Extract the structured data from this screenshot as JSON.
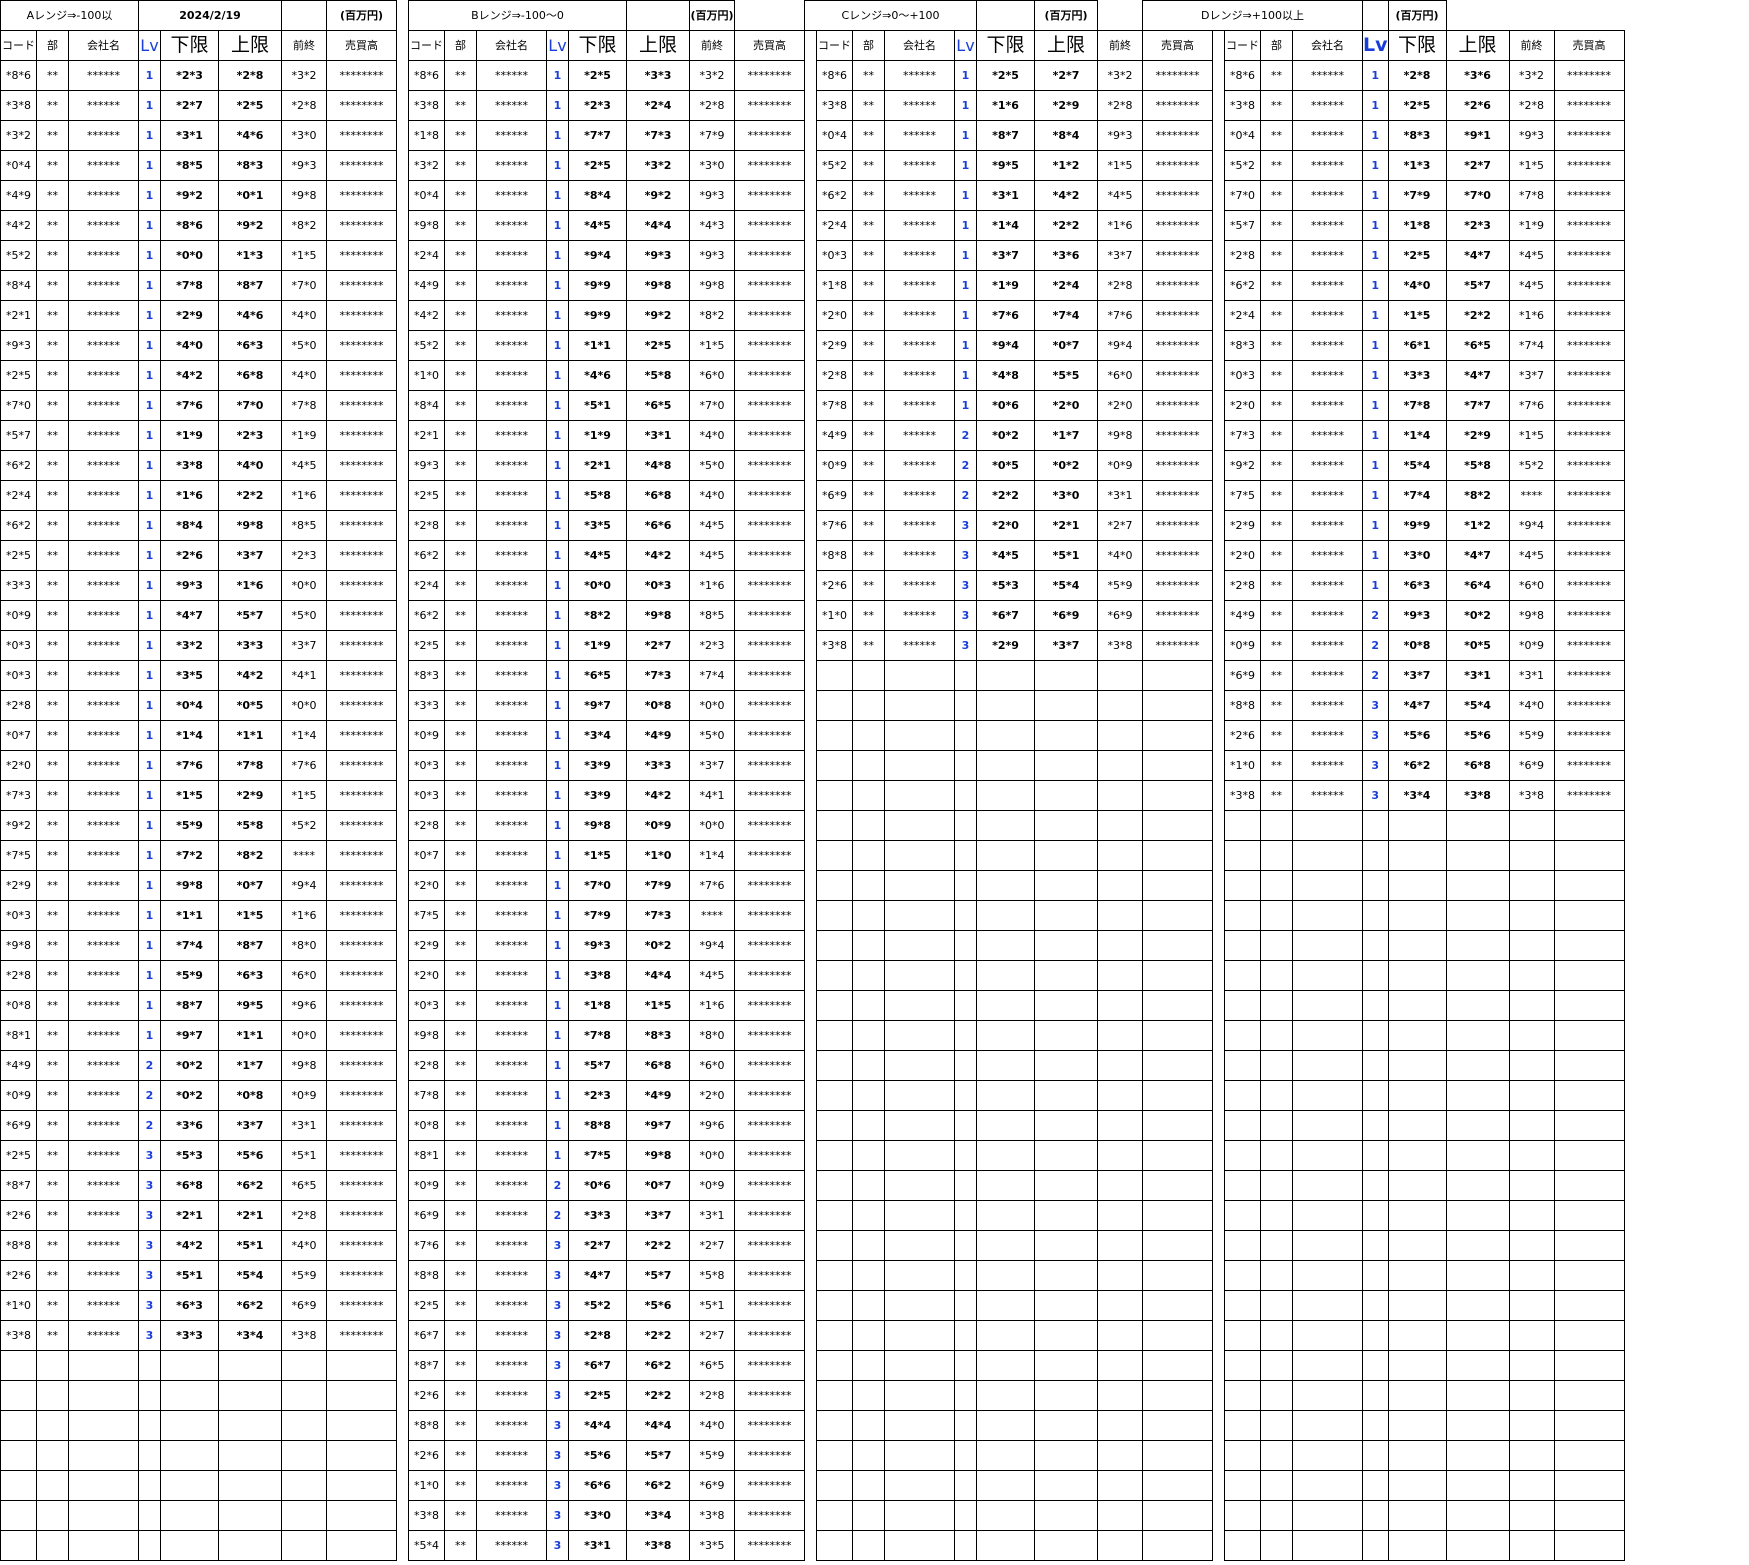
{
  "header": {
    "date": "2024/2/19",
    "unit_label": "(百万円)",
    "sections": [
      {
        "key": "A",
        "title": "Aレンジ⇒-100以"
      },
      {
        "key": "B",
        "title": "Bレンジ⇒-100〜0"
      },
      {
        "key": "C",
        "title": "Cレンジ⇒0〜+100"
      },
      {
        "key": "D",
        "title": "Dレンジ⇒+100以上"
      }
    ],
    "columns": [
      "コード",
      "部",
      "会社名",
      "Lv",
      "下限",
      "上限",
      "前終",
      "売買高"
    ]
  },
  "colors": {
    "lv": "#1a3fd9",
    "grid": "#000000"
  },
  "masks": {
    "bu": "**",
    "name": "******",
    "sales": "********"
  },
  "sections": {
    "A": [
      [
        "*8*6",
        "1",
        "*2*3",
        "*2*8",
        "*3*2"
      ],
      [
        "*3*8",
        "1",
        "*2*7",
        "*2*5",
        "*2*8"
      ],
      [
        "*3*2",
        "1",
        "*3*1",
        "*4*6",
        "*3*0"
      ],
      [
        "*0*4",
        "1",
        "*8*5",
        "*8*3",
        "*9*3"
      ],
      [
        "*4*9",
        "1",
        "*9*2",
        "*0*1",
        "*9*8"
      ],
      [
        "*4*2",
        "1",
        "*8*6",
        "*9*2",
        "*8*2"
      ],
      [
        "*5*2",
        "1",
        "*0*0",
        "*1*3",
        "*1*5"
      ],
      [
        "*8*4",
        "1",
        "*7*8",
        "*8*7",
        "*7*0"
      ],
      [
        "*2*1",
        "1",
        "*2*9",
        "*4*6",
        "*4*0"
      ],
      [
        "*9*3",
        "1",
        "*4*0",
        "*6*3",
        "*5*0"
      ],
      [
        "*2*5",
        "1",
        "*4*2",
        "*6*8",
        "*4*0"
      ],
      [
        "*7*0",
        "1",
        "*7*6",
        "*7*0",
        "*7*8"
      ],
      [
        "*5*7",
        "1",
        "*1*9",
        "*2*3",
        "*1*9"
      ],
      [
        "*6*2",
        "1",
        "*3*8",
        "*4*0",
        "*4*5"
      ],
      [
        "*2*4",
        "1",
        "*1*6",
        "*2*2",
        "*1*6"
      ],
      [
        "*6*2",
        "1",
        "*8*4",
        "*9*8",
        "*8*5"
      ],
      [
        "*2*5",
        "1",
        "*2*6",
        "*3*7",
        "*2*3"
      ],
      [
        "*3*3",
        "1",
        "*9*3",
        "*1*6",
        "*0*0"
      ],
      [
        "*0*9",
        "1",
        "*4*7",
        "*5*7",
        "*5*0"
      ],
      [
        "*0*3",
        "1",
        "*3*2",
        "*3*3",
        "*3*7"
      ],
      [
        "*0*3",
        "1",
        "*3*5",
        "*4*2",
        "*4*1"
      ],
      [
        "*2*8",
        "1",
        "*0*4",
        "*0*5",
        "*0*0"
      ],
      [
        "*0*7",
        "1",
        "*1*4",
        "*1*1",
        "*1*4"
      ],
      [
        "*2*0",
        "1",
        "*7*6",
        "*7*8",
        "*7*6"
      ],
      [
        "*7*3",
        "1",
        "*1*5",
        "*2*9",
        "*1*5"
      ],
      [
        "*9*2",
        "1",
        "*5*9",
        "*5*8",
        "*5*2"
      ],
      [
        "*7*5",
        "1",
        "*7*2",
        "*8*2",
        "****"
      ],
      [
        "*2*9",
        "1",
        "*9*8",
        "*0*7",
        "*9*4"
      ],
      [
        "*0*3",
        "1",
        "*1*1",
        "*1*5",
        "*1*6"
      ],
      [
        "*9*8",
        "1",
        "*7*4",
        "*8*7",
        "*8*0"
      ],
      [
        "*2*8",
        "1",
        "*5*9",
        "*6*3",
        "*6*0"
      ],
      [
        "*0*8",
        "1",
        "*8*7",
        "*9*5",
        "*9*6"
      ],
      [
        "*8*1",
        "1",
        "*9*7",
        "*1*1",
        "*0*0"
      ],
      [
        "*4*9",
        "2",
        "*0*2",
        "*1*7",
        "*9*8"
      ],
      [
        "*0*9",
        "2",
        "*0*2",
        "*0*8",
        "*0*9"
      ],
      [
        "*6*9",
        "2",
        "*3*6",
        "*3*7",
        "*3*1"
      ],
      [
        "*2*5",
        "3",
        "*5*3",
        "*5*6",
        "*5*1"
      ],
      [
        "*8*7",
        "3",
        "*6*8",
        "*6*2",
        "*6*5"
      ],
      [
        "*2*6",
        "3",
        "*2*1",
        "*2*1",
        "*2*8"
      ],
      [
        "*8*8",
        "3",
        "*4*2",
        "*5*1",
        "*4*0"
      ],
      [
        "*2*6",
        "3",
        "*5*1",
        "*5*4",
        "*5*9"
      ],
      [
        "*1*0",
        "3",
        "*6*3",
        "*6*2",
        "*6*9"
      ],
      [
        "*3*8",
        "3",
        "*3*3",
        "*3*4",
        "*3*8"
      ]
    ],
    "B": [
      [
        "*8*6",
        "1",
        "*2*5",
        "*3*3",
        "*3*2"
      ],
      [
        "*3*8",
        "1",
        "*2*3",
        "*2*4",
        "*2*8"
      ],
      [
        "*1*8",
        "1",
        "*7*7",
        "*7*3",
        "*7*9"
      ],
      [
        "*3*2",
        "1",
        "*2*5",
        "*3*2",
        "*3*0"
      ],
      [
        "*0*4",
        "1",
        "*8*4",
        "*9*2",
        "*9*3"
      ],
      [
        "*9*8",
        "1",
        "*4*5",
        "*4*4",
        "*4*3"
      ],
      [
        "*2*4",
        "1",
        "*9*4",
        "*9*3",
        "*9*3"
      ],
      [
        "*4*9",
        "1",
        "*9*9",
        "*9*8",
        "*9*8"
      ],
      [
        "*4*2",
        "1",
        "*9*9",
        "*9*2",
        "*8*2"
      ],
      [
        "*5*2",
        "1",
        "*1*1",
        "*2*5",
        "*1*5"
      ],
      [
        "*1*0",
        "1",
        "*4*6",
        "*5*8",
        "*6*0"
      ],
      [
        "*8*4",
        "1",
        "*5*1",
        "*6*5",
        "*7*0"
      ],
      [
        "*2*1",
        "1",
        "*1*9",
        "*3*1",
        "*4*0"
      ],
      [
        "*9*3",
        "1",
        "*2*1",
        "*4*8",
        "*5*0"
      ],
      [
        "*2*5",
        "1",
        "*5*8",
        "*6*8",
        "*4*0"
      ],
      [
        "*2*8",
        "1",
        "*3*5",
        "*6*6",
        "*4*5"
      ],
      [
        "*6*2",
        "1",
        "*4*5",
        "*4*2",
        "*4*5"
      ],
      [
        "*2*4",
        "1",
        "*0*0",
        "*0*3",
        "*1*6"
      ],
      [
        "*6*2",
        "1",
        "*8*2",
        "*9*8",
        "*8*5"
      ],
      [
        "*2*5",
        "1",
        "*1*9",
        "*2*7",
        "*2*3"
      ],
      [
        "*8*3",
        "1",
        "*6*5",
        "*7*3",
        "*7*4"
      ],
      [
        "*3*3",
        "1",
        "*9*7",
        "*0*8",
        "*0*0"
      ],
      [
        "*0*9",
        "1",
        "*3*4",
        "*4*9",
        "*5*0"
      ],
      [
        "*0*3",
        "1",
        "*3*9",
        "*3*3",
        "*3*7"
      ],
      [
        "*0*3",
        "1",
        "*3*9",
        "*4*2",
        "*4*1"
      ],
      [
        "*2*8",
        "1",
        "*9*8",
        "*0*9",
        "*0*0"
      ],
      [
        "*0*7",
        "1",
        "*1*5",
        "*1*0",
        "*1*4"
      ],
      [
        "*2*0",
        "1",
        "*7*0",
        "*7*9",
        "*7*6"
      ],
      [
        "*7*5",
        "1",
        "*7*9",
        "*7*3",
        "****"
      ],
      [
        "*2*9",
        "1",
        "*9*3",
        "*0*2",
        "*9*4"
      ],
      [
        "*2*0",
        "1",
        "*3*8",
        "*4*4",
        "*4*5"
      ],
      [
        "*0*3",
        "1",
        "*1*8",
        "*1*5",
        "*1*6"
      ],
      [
        "*9*8",
        "1",
        "*7*8",
        "*8*3",
        "*8*0"
      ],
      [
        "*2*8",
        "1",
        "*5*7",
        "*6*8",
        "*6*0"
      ],
      [
        "*7*8",
        "1",
        "*2*3",
        "*4*9",
        "*2*0"
      ],
      [
        "*0*8",
        "1",
        "*8*8",
        "*9*7",
        "*9*6"
      ],
      [
        "*8*1",
        "1",
        "*7*5",
        "*9*8",
        "*0*0"
      ],
      [
        "*0*9",
        "2",
        "*0*6",
        "*0*7",
        "*0*9"
      ],
      [
        "*6*9",
        "2",
        "*3*3",
        "*3*7",
        "*3*1"
      ],
      [
        "*7*6",
        "3",
        "*2*7",
        "*2*2",
        "*2*7"
      ],
      [
        "*8*8",
        "3",
        "*4*7",
        "*5*7",
        "*5*8"
      ],
      [
        "*2*5",
        "3",
        "*5*2",
        "*5*6",
        "*5*1"
      ],
      [
        "*6*7",
        "3",
        "*2*8",
        "*2*2",
        "*2*7"
      ],
      [
        "*8*7",
        "3",
        "*6*7",
        "*6*2",
        "*6*5"
      ],
      [
        "*2*6",
        "3",
        "*2*5",
        "*2*2",
        "*2*8"
      ],
      [
        "*8*8",
        "3",
        "*4*4",
        "*4*4",
        "*4*0"
      ],
      [
        "*2*6",
        "3",
        "*5*6",
        "*5*7",
        "*5*9"
      ],
      [
        "*1*0",
        "3",
        "*6*6",
        "*6*2",
        "*6*9"
      ],
      [
        "*3*8",
        "3",
        "*3*0",
        "*3*4",
        "*3*8"
      ],
      [
        "*5*4",
        "3",
        "*3*1",
        "*3*8",
        "*3*5"
      ]
    ],
    "C": [
      [
        "*8*6",
        "1",
        "*2*5",
        "*2*7",
        "*3*2"
      ],
      [
        "*3*8",
        "1",
        "*1*6",
        "*2*9",
        "*2*8"
      ],
      [
        "*0*4",
        "1",
        "*8*7",
        "*8*4",
        "*9*3"
      ],
      [
        "*5*2",
        "1",
        "*9*5",
        "*1*2",
        "*1*5"
      ],
      [
        "*6*2",
        "1",
        "*3*1",
        "*4*2",
        "*4*5"
      ],
      [
        "*2*4",
        "1",
        "*1*4",
        "*2*2",
        "*1*6"
      ],
      [
        "*0*3",
        "1",
        "*3*7",
        "*3*6",
        "*3*7"
      ],
      [
        "*1*8",
        "1",
        "*1*9",
        "*2*4",
        "*2*8"
      ],
      [
        "*2*0",
        "1",
        "*7*6",
        "*7*4",
        "*7*6"
      ],
      [
        "*2*9",
        "1",
        "*9*4",
        "*0*7",
        "*9*4"
      ],
      [
        "*2*8",
        "1",
        "*4*8",
        "*5*5",
        "*6*0"
      ],
      [
        "*7*8",
        "1",
        "*0*6",
        "*2*0",
        "*2*0"
      ],
      [
        "*4*9",
        "2",
        "*0*2",
        "*1*7",
        "*9*8"
      ],
      [
        "*0*9",
        "2",
        "*0*5",
        "*0*2",
        "*0*9"
      ],
      [
        "*6*9",
        "2",
        "*2*2",
        "*3*0",
        "*3*1"
      ],
      [
        "*7*6",
        "3",
        "*2*0",
        "*2*1",
        "*2*7"
      ],
      [
        "*8*8",
        "3",
        "*4*5",
        "*5*1",
        "*4*0"
      ],
      [
        "*2*6",
        "3",
        "*5*3",
        "*5*4",
        "*5*9"
      ],
      [
        "*1*0",
        "3",
        "*6*7",
        "*6*9",
        "*6*9"
      ],
      [
        "*3*8",
        "3",
        "*2*9",
        "*3*7",
        "*3*8"
      ]
    ],
    "D": [
      [
        "*8*6",
        "1",
        "*2*8",
        "*3*6",
        "*3*2"
      ],
      [
        "*3*8",
        "1",
        "*2*5",
        "*2*6",
        "*2*8"
      ],
      [
        "*0*4",
        "1",
        "*8*3",
        "*9*1",
        "*9*3"
      ],
      [
        "*5*2",
        "1",
        "*1*3",
        "*2*7",
        "*1*5"
      ],
      [
        "*7*0",
        "1",
        "*7*9",
        "*7*0",
        "*7*8"
      ],
      [
        "*5*7",
        "1",
        "*1*8",
        "*2*3",
        "*1*9"
      ],
      [
        "*2*8",
        "1",
        "*2*5",
        "*4*7",
        "*4*5"
      ],
      [
        "*6*2",
        "1",
        "*4*0",
        "*5*7",
        "*4*5"
      ],
      [
        "*2*4",
        "1",
        "*1*5",
        "*2*2",
        "*1*6"
      ],
      [
        "*8*3",
        "1",
        "*6*1",
        "*6*5",
        "*7*4"
      ],
      [
        "*0*3",
        "1",
        "*3*3",
        "*4*7",
        "*3*7"
      ],
      [
        "*2*0",
        "1",
        "*7*8",
        "*7*7",
        "*7*6"
      ],
      [
        "*7*3",
        "1",
        "*1*4",
        "*2*9",
        "*1*5"
      ],
      [
        "*9*2",
        "1",
        "*5*4",
        "*5*8",
        "*5*2"
      ],
      [
        "*7*5",
        "1",
        "*7*4",
        "*8*2",
        "****"
      ],
      [
        "*2*9",
        "1",
        "*9*9",
        "*1*2",
        "*9*4"
      ],
      [
        "*2*0",
        "1",
        "*3*0",
        "*4*7",
        "*4*5"
      ],
      [
        "*2*8",
        "1",
        "*6*3",
        "*6*4",
        "*6*0"
      ],
      [
        "*4*9",
        "2",
        "*9*3",
        "*0*2",
        "*9*8"
      ],
      [
        "*0*9",
        "2",
        "*0*8",
        "*0*5",
        "*0*9"
      ],
      [
        "*6*9",
        "2",
        "*3*7",
        "*3*1",
        "*3*1"
      ],
      [
        "*8*8",
        "3",
        "*4*7",
        "*5*4",
        "*4*0"
      ],
      [
        "*2*6",
        "3",
        "*5*6",
        "*5*6",
        "*5*9"
      ],
      [
        "*1*0",
        "3",
        "*6*2",
        "*6*8",
        "*6*9"
      ],
      [
        "*3*8",
        "3",
        "*3*4",
        "*3*8",
        "*3*8"
      ]
    ]
  }
}
